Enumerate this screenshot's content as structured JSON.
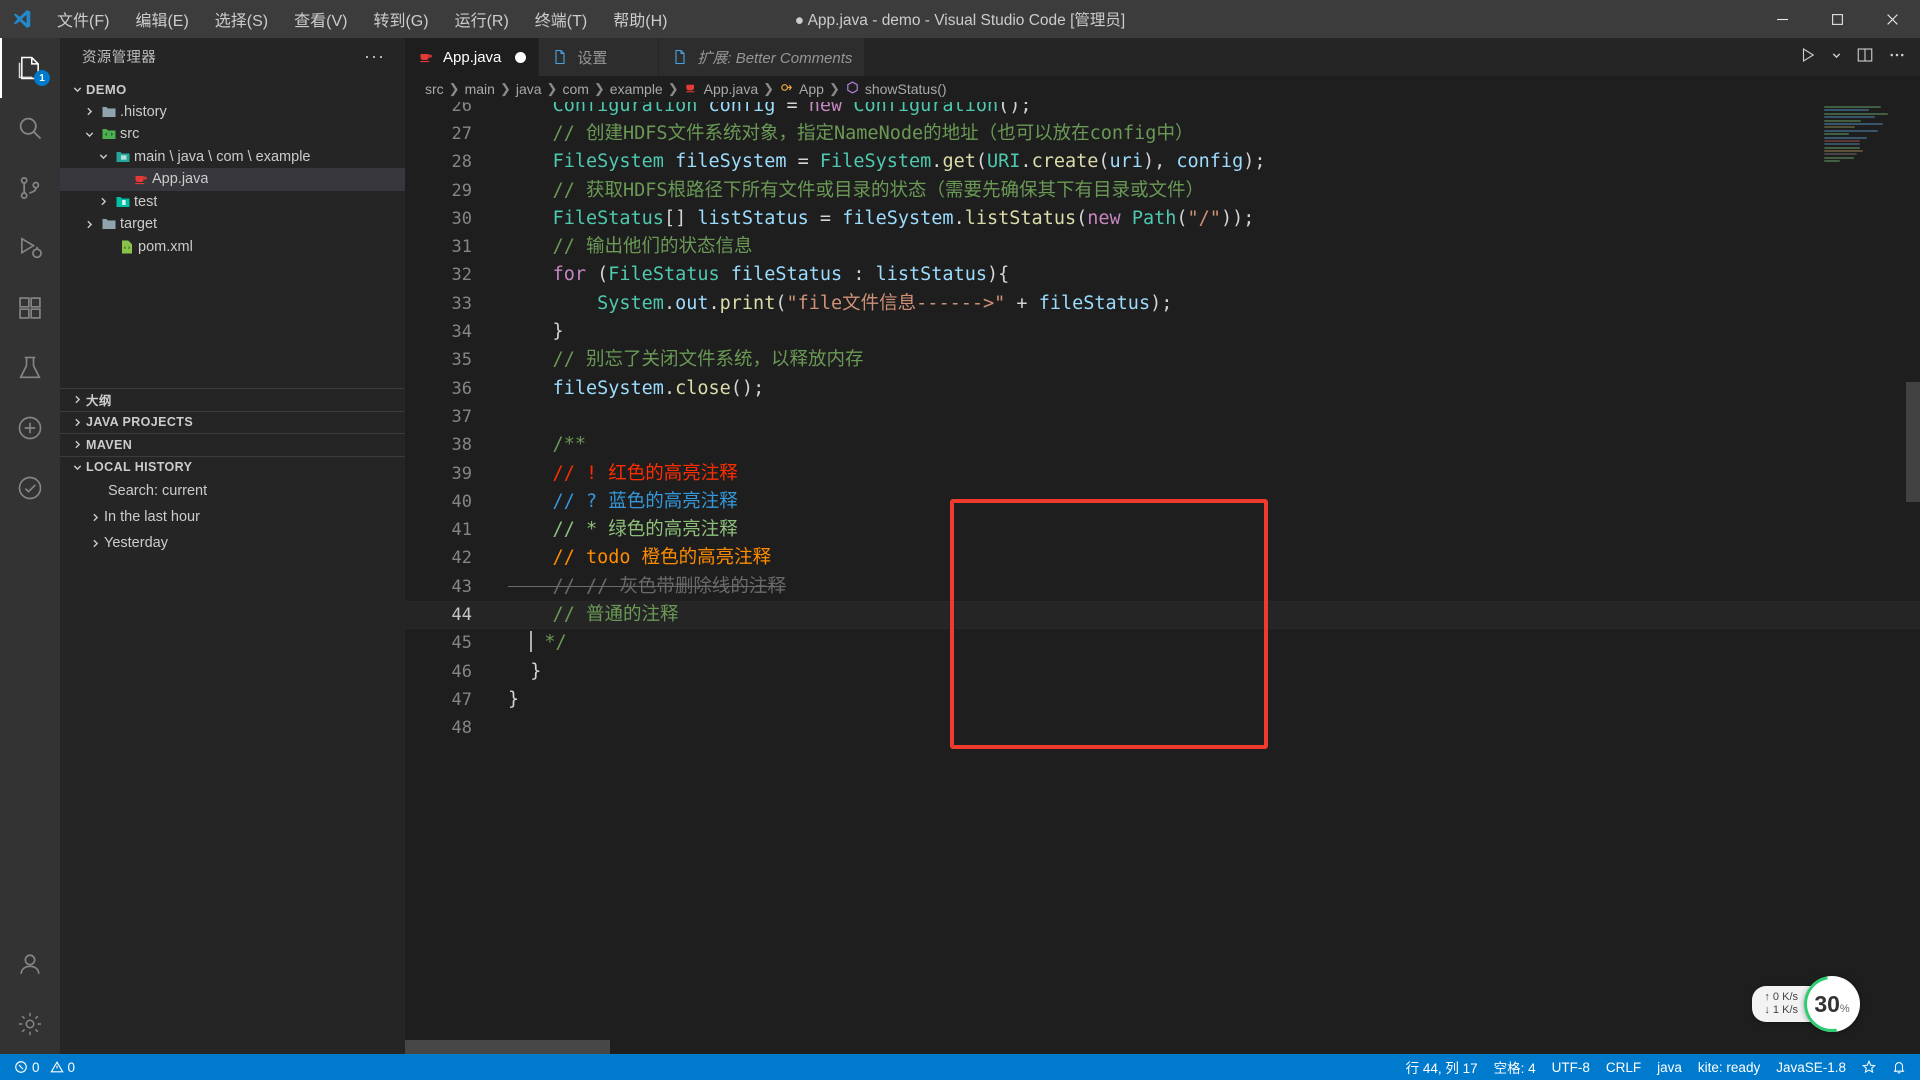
{
  "titlebar": {
    "title": "● App.java - demo - Visual Studio Code [管理员]",
    "menus": [
      "文件(F)",
      "编辑(E)",
      "选择(S)",
      "查看(V)",
      "转到(G)",
      "运行(R)",
      "终端(T)",
      "帮助(H)"
    ],
    "minimize_label": "最小化",
    "maximize_label": "还原",
    "close_label": "关闭"
  },
  "activitybar": {
    "items": [
      {
        "name": "explorer",
        "badge": "1"
      },
      {
        "name": "search",
        "badge": ""
      },
      {
        "name": "source-control",
        "badge": ""
      },
      {
        "name": "run-debug",
        "badge": ""
      },
      {
        "name": "extensions",
        "badge": ""
      },
      {
        "name": "testing",
        "badge": ""
      },
      {
        "name": "remote",
        "badge": ""
      },
      {
        "name": "todo-tree",
        "badge": ""
      }
    ],
    "accounts_label": "帐户",
    "settings_label": "管理"
  },
  "sidebar": {
    "header": "资源管理器",
    "more_actions": "···",
    "tree": [
      {
        "label": "DEMO",
        "indent": 0,
        "twisty": "down",
        "icon": "none",
        "root": true,
        "selected": false
      },
      {
        "label": ".history",
        "indent": 1,
        "twisty": "right",
        "icon": "folder",
        "root": false,
        "selected": false
      },
      {
        "label": "src",
        "indent": 1,
        "twisty": "down",
        "icon": "folder-src",
        "root": false,
        "selected": false
      },
      {
        "label": "main \\ java \\ com \\ example",
        "indent": 2,
        "twisty": "down",
        "icon": "folder-java",
        "root": false,
        "selected": false
      },
      {
        "label": "App.java",
        "indent": 3,
        "twisty": "none",
        "icon": "java",
        "root": false,
        "selected": true
      },
      {
        "label": "test",
        "indent": 1,
        "twisty": "right",
        "icon": "folder-test",
        "root": false,
        "selected": false
      },
      {
        "label": "target",
        "indent": 1,
        "twisty": "right",
        "icon": "folder",
        "root": false,
        "selected": false
      },
      {
        "label": "pom.xml",
        "indent": 1,
        "twisty": "none",
        "icon": "xml",
        "root": false,
        "selected": false
      }
    ],
    "sections": [
      {
        "label": "大纲",
        "expanded": false
      },
      {
        "label": "JAVA PROJECTS",
        "expanded": false
      },
      {
        "label": "MAVEN",
        "expanded": false
      },
      {
        "label": "LOCAL HISTORY",
        "expanded": true
      }
    ],
    "local_history": [
      {
        "label": "Search: current",
        "twisty": "none"
      },
      {
        "label": "In the last hour",
        "twisty": "right"
      },
      {
        "label": "Yesterday",
        "twisty": "right"
      }
    ]
  },
  "tabs": [
    {
      "label": "App.java",
      "icon": "java",
      "active": true,
      "dirty": true,
      "italic": false
    },
    {
      "label": "设置",
      "icon": "file",
      "active": false,
      "dirty": false,
      "italic": false
    },
    {
      "label": "扩展: Better Comments",
      "icon": "file",
      "active": false,
      "dirty": false,
      "italic": true
    }
  ],
  "tab_actions": {
    "run_label": "运行代码",
    "split_label": "拆分编辑器",
    "more_label": "更多操作"
  },
  "breadcrumbs": [
    {
      "label": "src",
      "icon": "none"
    },
    {
      "label": "main",
      "icon": "none"
    },
    {
      "label": "java",
      "icon": "none"
    },
    {
      "label": "com",
      "icon": "none"
    },
    {
      "label": "example",
      "icon": "none"
    },
    {
      "label": "App.java",
      "icon": "java"
    },
    {
      "label": "App",
      "icon": "class"
    },
    {
      "label": "showStatus()",
      "icon": "method"
    }
  ],
  "code": {
    "first_line": 26,
    "current_line": 44,
    "lines": [
      {
        "n": 26,
        "tokens": [
          {
            "t": "Configuration",
            "c": "t-type"
          },
          {
            "t": " ",
            "c": "t-pln"
          },
          {
            "t": "config",
            "c": "t-var"
          },
          {
            "t": " = ",
            "c": "t-pln"
          },
          {
            "t": "new",
            "c": "t-kw"
          },
          {
            "t": " ",
            "c": "t-pln"
          },
          {
            "t": "Configuration",
            "c": "t-type"
          },
          {
            "t": "();",
            "c": "t-pln"
          }
        ],
        "indent": 2
      },
      {
        "n": 27,
        "tokens": [
          {
            "t": "// 创建HDFS文件系统对象，指定NameNode的地址（也可以放在config中）",
            "c": "t-cmt"
          }
        ],
        "indent": 2
      },
      {
        "n": 28,
        "tokens": [
          {
            "t": "FileSystem",
            "c": "t-type"
          },
          {
            "t": " ",
            "c": "t-pln"
          },
          {
            "t": "fileSystem",
            "c": "t-var"
          },
          {
            "t": " = ",
            "c": "t-pln"
          },
          {
            "t": "FileSystem",
            "c": "t-type"
          },
          {
            "t": ".",
            "c": "t-pln"
          },
          {
            "t": "get",
            "c": "t-fn"
          },
          {
            "t": "(",
            "c": "t-pln"
          },
          {
            "t": "URI",
            "c": "t-type"
          },
          {
            "t": ".",
            "c": "t-pln"
          },
          {
            "t": "create",
            "c": "t-fn"
          },
          {
            "t": "(",
            "c": "t-pln"
          },
          {
            "t": "uri",
            "c": "t-var"
          },
          {
            "t": "), ",
            "c": "t-pln"
          },
          {
            "t": "config",
            "c": "t-var"
          },
          {
            "t": ");",
            "c": "t-pln"
          }
        ],
        "indent": 2
      },
      {
        "n": 29,
        "tokens": [
          {
            "t": "// 获取HDFS根路径下所有文件或目录的状态（需要先确保其下有目录或文件）",
            "c": "t-cmt"
          }
        ],
        "indent": 2
      },
      {
        "n": 30,
        "tokens": [
          {
            "t": "FileStatus",
            "c": "t-type"
          },
          {
            "t": "[] ",
            "c": "t-pln"
          },
          {
            "t": "listStatus",
            "c": "t-var"
          },
          {
            "t": " = ",
            "c": "t-pln"
          },
          {
            "t": "fileSystem",
            "c": "t-var"
          },
          {
            "t": ".",
            "c": "t-pln"
          },
          {
            "t": "listStatus",
            "c": "t-fn"
          },
          {
            "t": "(",
            "c": "t-pln"
          },
          {
            "t": "new",
            "c": "t-kw"
          },
          {
            "t": " ",
            "c": "t-pln"
          },
          {
            "t": "Path",
            "c": "t-type"
          },
          {
            "t": "(",
            "c": "t-pln"
          },
          {
            "t": "\"/\"",
            "c": "t-str"
          },
          {
            "t": "));",
            "c": "t-pln"
          }
        ],
        "indent": 2
      },
      {
        "n": 31,
        "tokens": [
          {
            "t": "// 输出他们的状态信息",
            "c": "t-cmt"
          }
        ],
        "indent": 2
      },
      {
        "n": 32,
        "tokens": [
          {
            "t": "for",
            "c": "t-kw"
          },
          {
            "t": " (",
            "c": "t-pln"
          },
          {
            "t": "FileStatus",
            "c": "t-type"
          },
          {
            "t": " ",
            "c": "t-pln"
          },
          {
            "t": "fileStatus",
            "c": "t-var"
          },
          {
            "t": " : ",
            "c": "t-pln"
          },
          {
            "t": "listStatus",
            "c": "t-var"
          },
          {
            "t": "){",
            "c": "t-pln"
          }
        ],
        "indent": 2
      },
      {
        "n": 33,
        "tokens": [
          {
            "t": "System",
            "c": "t-type"
          },
          {
            "t": ".",
            "c": "t-pln"
          },
          {
            "t": "out",
            "c": "t-var"
          },
          {
            "t": ".",
            "c": "t-pln"
          },
          {
            "t": "print",
            "c": "t-fn"
          },
          {
            "t": "(",
            "c": "t-pln"
          },
          {
            "t": "\"file文件信息------>\"",
            "c": "t-str"
          },
          {
            "t": " + ",
            "c": "t-pln"
          },
          {
            "t": "fileStatus",
            "c": "t-var"
          },
          {
            "t": ");",
            "c": "t-pln"
          }
        ],
        "indent": 3
      },
      {
        "n": 34,
        "tokens": [
          {
            "t": "}",
            "c": "t-pln"
          }
        ],
        "indent": 2
      },
      {
        "n": 35,
        "tokens": [
          {
            "t": "// 别忘了关闭文件系统，以释放内存",
            "c": "t-cmt"
          }
        ],
        "indent": 2
      },
      {
        "n": 36,
        "tokens": [
          {
            "t": "fileSystem",
            "c": "t-var"
          },
          {
            "t": ".",
            "c": "t-pln"
          },
          {
            "t": "close",
            "c": "t-fn"
          },
          {
            "t": "();",
            "c": "t-pln"
          }
        ],
        "indent": 2
      },
      {
        "n": 37,
        "tokens": [],
        "indent": 0
      },
      {
        "n": 38,
        "tokens": [
          {
            "t": "/**",
            "c": "t-cmt"
          }
        ],
        "indent": 2
      },
      {
        "n": 39,
        "tokens": [
          {
            "t": "// ! 红色的高亮注释",
            "c": "bc-red"
          }
        ],
        "indent": 2
      },
      {
        "n": 40,
        "tokens": [
          {
            "t": "// ? 蓝色的高亮注释",
            "c": "bc-blue"
          }
        ],
        "indent": 2
      },
      {
        "n": 41,
        "tokens": [
          {
            "t": "// * 绿色的高亮注释",
            "c": "bc-green"
          }
        ],
        "indent": 2
      },
      {
        "n": 42,
        "tokens": [
          {
            "t": "// todo 橙色的高亮注释",
            "c": "bc-orange"
          }
        ],
        "indent": 2
      },
      {
        "n": 43,
        "tokens": [
          {
            "t": "// // 灰色带删除线的注释",
            "c": "bc-strike"
          }
        ],
        "indent": 2
      },
      {
        "n": 44,
        "tokens": [
          {
            "t": "// 普通的注释",
            "c": "t-cmt"
          }
        ],
        "indent": 2
      },
      {
        "n": 45,
        "tokens": [
          {
            "t": "*/",
            "c": "t-cmt"
          }
        ],
        "indent": 2,
        "cursor": true
      },
      {
        "n": 46,
        "tokens": [
          {
            "t": "}",
            "c": "t-pln"
          }
        ],
        "indent": 1
      },
      {
        "n": 47,
        "tokens": [
          {
            "t": "}",
            "c": "t-pln"
          }
        ],
        "indent": 0
      },
      {
        "n": 48,
        "tokens": [],
        "indent": 0
      }
    ]
  },
  "netspeed": {
    "up": "↑ 0   K/s",
    "down": "↓ 1   K/s",
    "cpu_value": "30",
    "cpu_unit": "%"
  },
  "statusbar": {
    "left": [
      {
        "name": "problems",
        "text": "0  ⚠ 0",
        "icon": "error"
      }
    ],
    "errors": "0",
    "warnings": "0",
    "right": [
      {
        "name": "cursor-position",
        "text": "行 44, 列 17"
      },
      {
        "name": "indentation",
        "text": "空格: 4"
      },
      {
        "name": "encoding",
        "text": "UTF-8"
      },
      {
        "name": "eol",
        "text": "CRLF"
      },
      {
        "name": "language-mode",
        "text": "java"
      },
      {
        "name": "kite-status",
        "text": "kite: ready"
      },
      {
        "name": "java-runtime",
        "text": "JavaSE-1.8"
      }
    ],
    "bell_label": "通知",
    "feedback_label": "发送反馈"
  },
  "colors": {
    "accent": "#007acc",
    "titlebar_bg": "#3c3c3c",
    "sidebar_bg": "#252526",
    "editor_bg": "#1e1e1e",
    "activitybar_bg": "#333333",
    "highlight_box": "#f03a2e",
    "comment_red": "#ff2d00",
    "comment_blue": "#3498db",
    "comment_green": "#8ec07c",
    "comment_orange": "#ff8c00",
    "comment_gray": "#6a6a6a"
  }
}
